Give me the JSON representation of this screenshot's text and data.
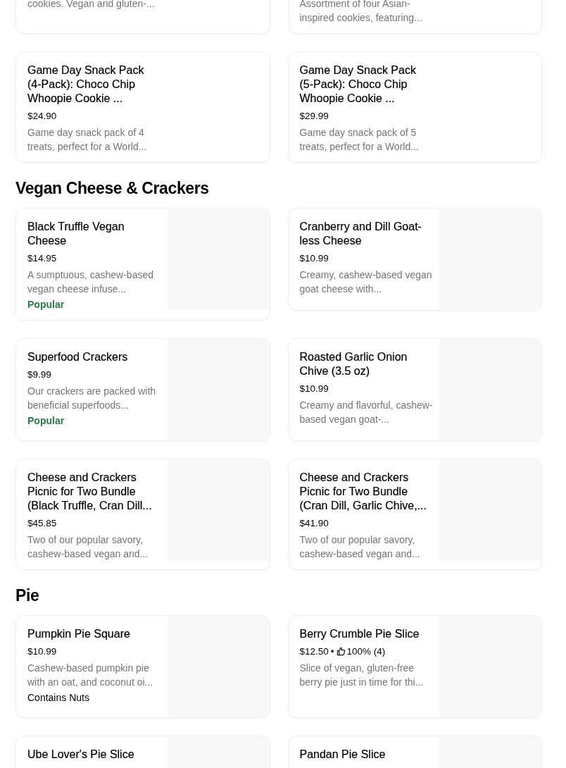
{
  "sections": [
    {
      "items": [
        {
          "description": "cookies. Vegan and gluten-...",
          "has_image": false
        },
        {
          "description": "Assortment of four Asian-inspired cookies, featuring...",
          "has_image": false
        },
        {
          "title": "Game Day Snack Pack (4-Pack): Choco Chip Whoopie Cookie ...",
          "price": "$24.90",
          "description": "Game day snack pack of 4 treats, perfect for a World...",
          "has_image": false
        },
        {
          "title": "Game Day Snack Pack (5-Pack): Choco Chip Whoopie Cookie ...",
          "price": "$29.99",
          "description": "Game day snack pack of 5 treats, perfect for a World...",
          "has_image": false
        }
      ]
    },
    {
      "heading": "Vegan Cheese & Crackers",
      "items": [
        {
          "title": "Black Truffle Vegan Cheese",
          "price": "$14.95",
          "description": "A sumptuous, cashew-based vegan cheese infuse...",
          "tag": {
            "kind": "popular",
            "text": "Popular"
          },
          "has_image": true
        },
        {
          "title": "Cranberry and Dill Goat-less Cheese",
          "price": "$10.99",
          "description": "Creamy, cashew-based vegan goat cheese with...",
          "has_image": true
        },
        {
          "title": "Superfood Crackers",
          "price": "$9.99",
          "description": "Our crackers are packed with beneficial superfoods...",
          "tag": {
            "kind": "popular",
            "text": "Popular"
          },
          "has_image": true
        },
        {
          "title": "Roasted Garlic Onion Chive (3.5 oz)",
          "price": "$10.99",
          "description": "Creamy and flavorful, cashew-based vegan goat-...",
          "has_image": true
        },
        {
          "title": "Cheese and Crackers Picnic for Two Bundle (Black Truffle, Cran Dill...",
          "price": "$45.85",
          "description": "Two of our popular savory, cashew-based vegan and...",
          "has_image": true
        },
        {
          "title": "Cheese and Crackers Picnic for Two Bundle (Cran Dill, Garlic Chive,...",
          "price": "$41.90",
          "description": "Two of our popular savory, cashew-based vegan and...",
          "has_image": true
        }
      ]
    },
    {
      "heading": "Pie",
      "items": [
        {
          "title": "Pumpkin Pie Square",
          "price": "$10.99",
          "description": "Cashew-based pumpkin pie with an oat, and coconut oi...",
          "tag": {
            "kind": "note",
            "text": "Contains Nuts"
          },
          "has_image": true
        },
        {
          "title": "Berry Crumble Pie Slice",
          "price": "$12.50",
          "separator": "•",
          "rating": "100% (4)",
          "description": "Slice of vegan, gluten-free berry pie just in time for thi...",
          "has_image": true
        },
        {
          "title": "Ube Lover's Pie Slice",
          "has_image": true
        },
        {
          "title": "Pandan Pie Slice",
          "has_image": true
        }
      ]
    }
  ]
}
